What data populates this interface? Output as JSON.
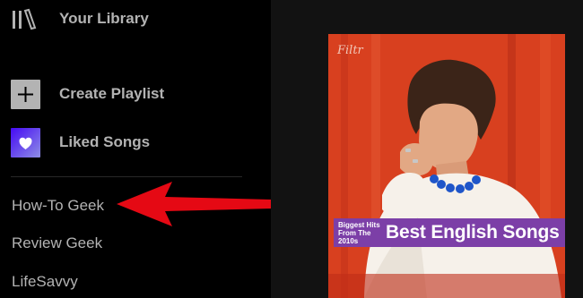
{
  "sidebar": {
    "library_label": "Your Library",
    "create_playlist_label": "Create Playlist",
    "liked_songs_label": "Liked Songs",
    "playlists": [
      "How-To Geek",
      "Review Geek",
      "LifeSavvy"
    ]
  },
  "cover": {
    "brand": "Filtr",
    "banner_small": "Biggest Hits From The 2010s",
    "banner_title": "Best English Songs"
  },
  "icons": {
    "library": "library-icon",
    "create": "plus-icon",
    "liked": "heart-icon",
    "annotation": "red-arrow-icon"
  },
  "colors": {
    "sidebar_bg": "#000000",
    "text": "#b3b3b3",
    "arrow": "#e50914",
    "banner": "#7c3fa7"
  }
}
